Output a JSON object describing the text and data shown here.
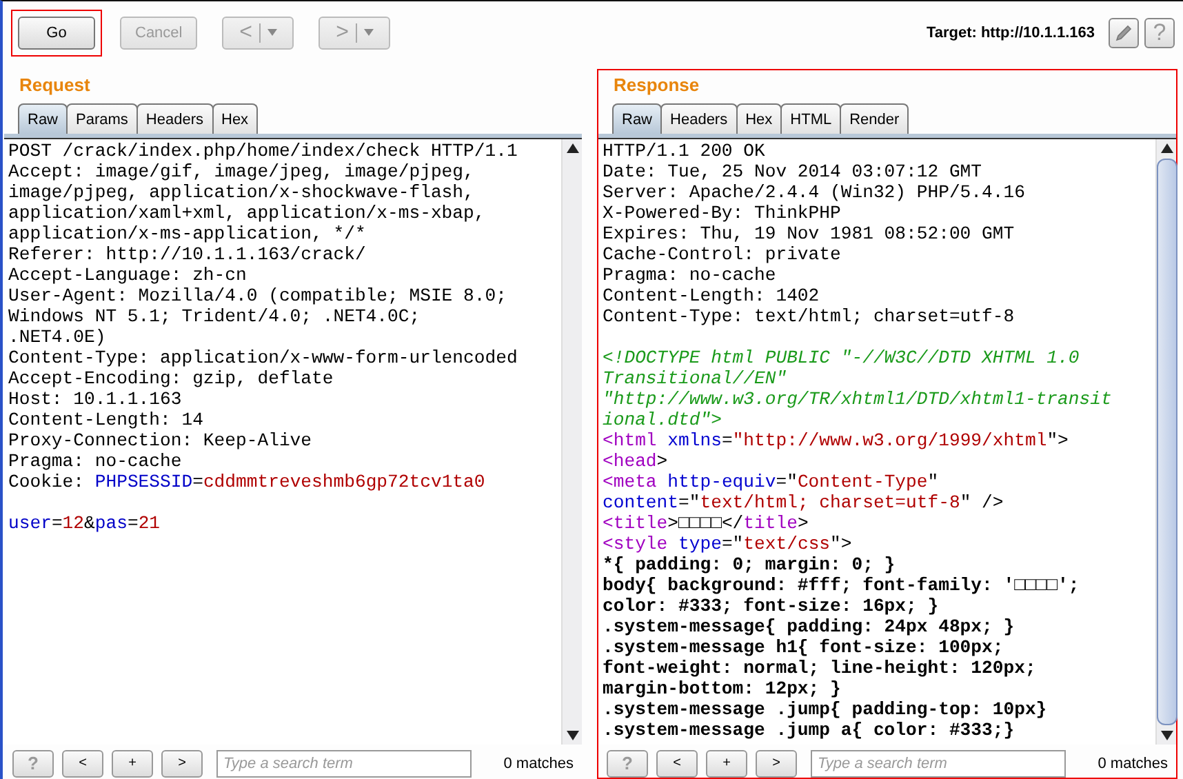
{
  "toolbar": {
    "buttons": [
      {
        "kind": "text",
        "label": "Go",
        "disabled": false,
        "highlighted": true
      },
      {
        "kind": "text",
        "label": "Cancel",
        "disabled": true
      },
      {
        "kind": "split",
        "label": "<",
        "disabled": true
      },
      {
        "kind": "split",
        "label": ">",
        "disabled": true
      }
    ],
    "target": "Target: http://10.1.1.163",
    "help": "?"
  },
  "panels": [
    {
      "title": "Request",
      "highlighted": false,
      "tabs": [
        {
          "label": "Raw",
          "selected": true
        },
        {
          "label": "Params",
          "selected": false
        },
        {
          "label": "Headers",
          "selected": false
        },
        {
          "label": "Hex",
          "selected": false
        }
      ],
      "lines": [
        {
          "kind": "code",
          "segments": [
            {
              "kind": "plain",
              "text": "POST /crack/index.php/home/index/check HTTP/1.1"
            }
          ]
        },
        {
          "kind": "code",
          "segments": [
            {
              "kind": "plain",
              "text": "Accept: image/gif, image/jpeg, image/pjpeg,"
            }
          ]
        },
        {
          "kind": "code",
          "segments": [
            {
              "kind": "plain",
              "text": "image/pjpeg, application/x-shockwave-flash,"
            }
          ]
        },
        {
          "kind": "code",
          "segments": [
            {
              "kind": "plain",
              "text": "application/xaml+xml, application/x-ms-xbap,"
            }
          ]
        },
        {
          "kind": "code",
          "segments": [
            {
              "kind": "plain",
              "text": "application/x-ms-application, */*"
            }
          ]
        },
        {
          "kind": "code",
          "segments": [
            {
              "kind": "plain",
              "text": "Referer: http://10.1.1.163/crack/"
            }
          ]
        },
        {
          "kind": "code",
          "segments": [
            {
              "kind": "plain",
              "text": "Accept-Language: zh-cn"
            }
          ]
        },
        {
          "kind": "code",
          "segments": [
            {
              "kind": "plain",
              "text": "User-Agent: Mozilla/4.0 (compatible; MSIE 8.0;"
            }
          ]
        },
        {
          "kind": "code",
          "segments": [
            {
              "kind": "plain",
              "text": "Windows NT 5.1; Trident/4.0; .NET4.0C;"
            }
          ]
        },
        {
          "kind": "code",
          "segments": [
            {
              "kind": "plain",
              "text": ".NET4.0E)"
            }
          ]
        },
        {
          "kind": "code",
          "segments": [
            {
              "kind": "plain",
              "text": "Content-Type: application/x-www-form-urlencoded"
            }
          ]
        },
        {
          "kind": "code",
          "segments": [
            {
              "kind": "plain",
              "text": "Accept-Encoding: gzip, deflate"
            }
          ]
        },
        {
          "kind": "code",
          "segments": [
            {
              "kind": "plain",
              "text": "Host: 10.1.1.163"
            }
          ]
        },
        {
          "kind": "code",
          "segments": [
            {
              "kind": "plain",
              "text": "Content-Length: 14"
            }
          ]
        },
        {
          "kind": "code",
          "segments": [
            {
              "kind": "plain",
              "text": "Proxy-Connection: Keep-Alive"
            }
          ]
        },
        {
          "kind": "code",
          "segments": [
            {
              "kind": "plain",
              "text": "Pragma: no-cache"
            }
          ]
        },
        {
          "kind": "code",
          "segments": [
            {
              "kind": "plain",
              "text": "Cookie: "
            },
            {
              "kind": "name",
              "text": "PHPSESSID"
            },
            {
              "kind": "plain",
              "text": "="
            },
            {
              "kind": "value",
              "text": "cddmmtreveshmb6gp72tcv1ta0"
            }
          ]
        },
        {
          "kind": "blank"
        },
        {
          "kind": "code",
          "segments": [
            {
              "kind": "name",
              "text": "user"
            },
            {
              "kind": "plain",
              "text": "="
            },
            {
              "kind": "value",
              "text": "12"
            },
            {
              "kind": "plain",
              "text": "&"
            },
            {
              "kind": "name",
              "text": "pas"
            },
            {
              "kind": "plain",
              "text": "="
            },
            {
              "kind": "value",
              "text": "21"
            }
          ]
        }
      ],
      "search": {
        "buttons": [
          "?",
          "<",
          "+",
          ">"
        ],
        "placeholder": "Type a search term",
        "matches": "0 matches"
      }
    },
    {
      "title": "Response",
      "highlighted": true,
      "tabs": [
        {
          "label": "Raw",
          "selected": true
        },
        {
          "label": "Headers",
          "selected": false
        },
        {
          "label": "Hex",
          "selected": false
        },
        {
          "label": "HTML",
          "selected": false
        },
        {
          "label": "Render",
          "selected": false
        }
      ],
      "lines": [
        {
          "kind": "code",
          "segments": [
            {
              "kind": "plain",
              "text": "HTTP/1.1 200 OK"
            }
          ]
        },
        {
          "kind": "code",
          "segments": [
            {
              "kind": "plain",
              "text": "Date: Tue, 25 Nov 2014 03:07:12 GMT"
            }
          ]
        },
        {
          "kind": "code",
          "segments": [
            {
              "kind": "plain",
              "text": "Server: Apache/2.4.4 (Win32) PHP/5.4.16"
            }
          ]
        },
        {
          "kind": "code",
          "segments": [
            {
              "kind": "plain",
              "text": "X-Powered-By: ThinkPHP"
            }
          ]
        },
        {
          "kind": "code",
          "segments": [
            {
              "kind": "plain",
              "text": "Expires: Thu, 19 Nov 1981 08:52:00 GMT"
            }
          ]
        },
        {
          "kind": "code",
          "segments": [
            {
              "kind": "plain",
              "text": "Cache-Control: private"
            }
          ]
        },
        {
          "kind": "code",
          "segments": [
            {
              "kind": "plain",
              "text": "Pragma: no-cache"
            }
          ]
        },
        {
          "kind": "code",
          "segments": [
            {
              "kind": "plain",
              "text": "Content-Length: 1402"
            }
          ]
        },
        {
          "kind": "code",
          "segments": [
            {
              "kind": "plain",
              "text": "Content-Type: text/html; charset=utf-8"
            }
          ]
        },
        {
          "kind": "blank"
        },
        {
          "kind": "code",
          "segments": [
            {
              "kind": "comment",
              "text": "<!DOCTYPE html PUBLIC \"-//W3C//DTD XHTML 1.0"
            }
          ]
        },
        {
          "kind": "code",
          "segments": [
            {
              "kind": "comment",
              "text": "Transitional//EN\""
            }
          ]
        },
        {
          "kind": "code",
          "segments": [
            {
              "kind": "comment",
              "text": "\"http://www.w3.org/TR/xhtml1/DTD/xhtml1-transit"
            }
          ]
        },
        {
          "kind": "code",
          "segments": [
            {
              "kind": "comment",
              "text": "ional.dtd\">"
            }
          ]
        },
        {
          "kind": "code",
          "segments": [
            {
              "kind": "tag",
              "text": "<html"
            },
            {
              "kind": "attr",
              "text": " xmlns"
            },
            {
              "kind": "plain",
              "text": "="
            },
            {
              "kind": "value",
              "text": "\"http://www.w3.org/1999/xhtml"
            },
            {
              "kind": "plain",
              "text": "\">"
            }
          ]
        },
        {
          "kind": "code",
          "segments": [
            {
              "kind": "tag",
              "text": "<head"
            },
            {
              "kind": "plain",
              "text": ">"
            }
          ]
        },
        {
          "kind": "code",
          "segments": [
            {
              "kind": "tag",
              "text": "<meta"
            },
            {
              "kind": "attr",
              "text": " http-equiv"
            },
            {
              "kind": "plain",
              "text": "=\""
            },
            {
              "kind": "value",
              "text": "Content-Type"
            },
            {
              "kind": "plain",
              "text": "\""
            }
          ]
        },
        {
          "kind": "code",
          "segments": [
            {
              "kind": "attr",
              "text": "content"
            },
            {
              "kind": "plain",
              "text": "=\""
            },
            {
              "kind": "value",
              "text": "text/html; charset=utf-8"
            },
            {
              "kind": "plain",
              "text": "\" />"
            }
          ]
        },
        {
          "kind": "code",
          "segments": [
            {
              "kind": "tag",
              "text": "<title"
            },
            {
              "kind": "plain",
              "text": ">□□□□</"
            },
            {
              "kind": "tag",
              "text": "title"
            },
            {
              "kind": "plain",
              "text": ">"
            }
          ]
        },
        {
          "kind": "code",
          "segments": [
            {
              "kind": "tag",
              "text": "<style"
            },
            {
              "kind": "attr",
              "text": " type"
            },
            {
              "kind": "plain",
              "text": "=\""
            },
            {
              "kind": "value",
              "text": "text/css"
            },
            {
              "kind": "plain",
              "text": "\">"
            }
          ]
        },
        {
          "kind": "code",
          "segments": [
            {
              "kind": "css",
              "text": "*{ padding: 0; margin: 0; }"
            }
          ]
        },
        {
          "kind": "code",
          "segments": [
            {
              "kind": "css",
              "text": "body{ background: #fff; font-family: '□□□□';"
            }
          ]
        },
        {
          "kind": "code",
          "segments": [
            {
              "kind": "css",
              "text": "color: #333; font-size: 16px; }"
            }
          ]
        },
        {
          "kind": "code",
          "segments": [
            {
              "kind": "css",
              "text": ".system-message{ padding: 24px 48px; }"
            }
          ]
        },
        {
          "kind": "code",
          "segments": [
            {
              "kind": "css",
              "text": ".system-message h1{ font-size: 100px;"
            }
          ]
        },
        {
          "kind": "code",
          "segments": [
            {
              "kind": "css",
              "text": "font-weight: normal; line-height: 120px;"
            }
          ]
        },
        {
          "kind": "code",
          "segments": [
            {
              "kind": "css",
              "text": "margin-bottom: 12px; }"
            }
          ]
        },
        {
          "kind": "code",
          "segments": [
            {
              "kind": "css",
              "text": ".system-message .jump{ padding-top: 10px}"
            }
          ]
        },
        {
          "kind": "code",
          "segments": [
            {
              "kind": "css",
              "text": ".system-message .jump a{ color: #333;}"
            }
          ]
        }
      ],
      "search": {
        "buttons": [
          "?",
          "<",
          "+",
          ">"
        ],
        "placeholder": "Type a search term",
        "matches": "0 matches"
      }
    }
  ]
}
